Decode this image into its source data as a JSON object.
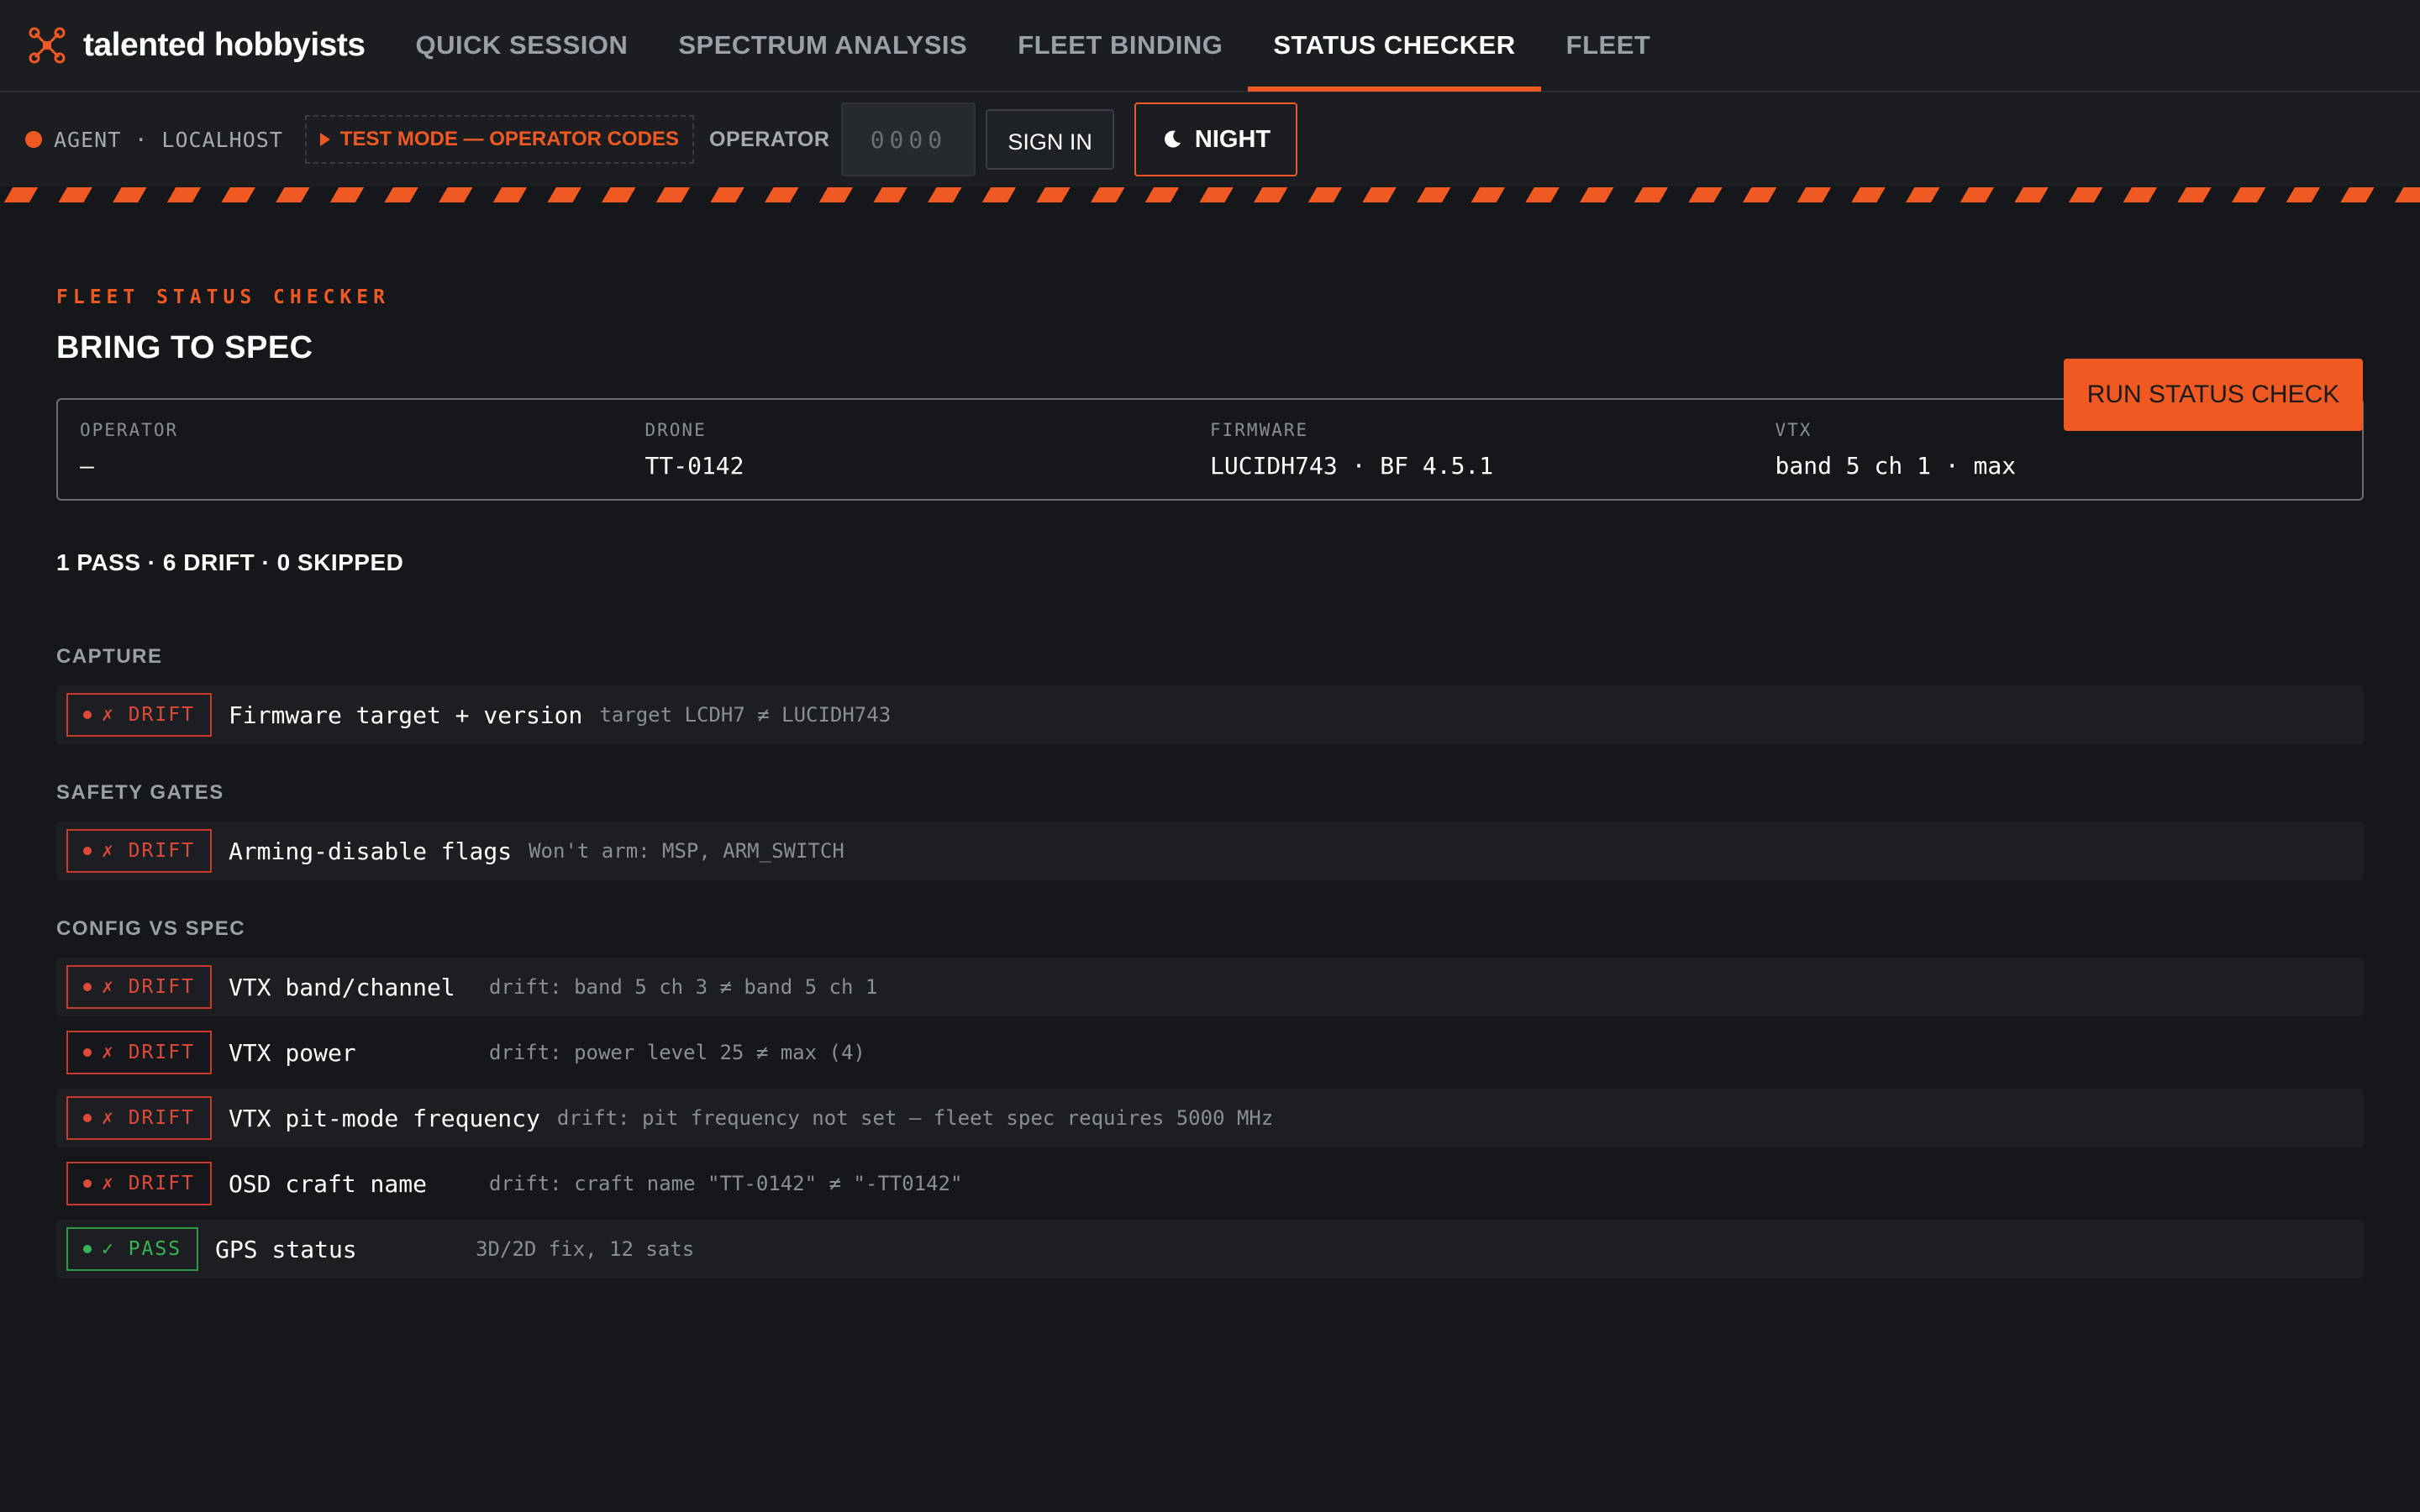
{
  "brand": {
    "name": "talented hobbyists"
  },
  "nav": {
    "tabs": [
      {
        "label": "QUICK SESSION"
      },
      {
        "label": "SPECTRUM ANALYSIS"
      },
      {
        "label": "FLEET BINDING"
      },
      {
        "label": "STATUS CHECKER",
        "active": true
      },
      {
        "label": "FLEET"
      }
    ]
  },
  "toolbar": {
    "agent_status": "AGENT · LOCALHOST",
    "test_mode": "TEST MODE — OPERATOR CODES",
    "operator_label": "OPERATOR",
    "operator_placeholder": "0000",
    "sign_in_label": "SIGN IN",
    "theme_label": "NIGHT"
  },
  "page": {
    "kicker": "FLEET STATUS CHECKER",
    "title": "BRING TO SPEC",
    "run_button": "RUN STATUS CHECK"
  },
  "info": {
    "operator": {
      "label": "OPERATOR",
      "value": "—"
    },
    "drone": {
      "label": "DRONE",
      "value": "TT-0142"
    },
    "firmware": {
      "label": "FIRMWARE",
      "value": "LUCIDH743 · BF 4.5.1"
    },
    "vtx": {
      "label": "VTX",
      "value": "band 5 ch 1 · max"
    }
  },
  "summary": "1 PASS · 6 DRIFT · 0 SKIPPED",
  "sections": [
    {
      "title": "CAPTURE",
      "checks": [
        {
          "status": "✗ DRIFT",
          "name": "Firmware target + version",
          "detail": "target LCDH7 ≠ LUCIDH743"
        }
      ]
    },
    {
      "title": "SAFETY GATES",
      "checks": [
        {
          "status": "✗ DRIFT",
          "name": "Arming-disable flags",
          "detail": "Won't arm: MSP, ARM_SWITCH"
        }
      ]
    },
    {
      "title": "CONFIG VS SPEC",
      "checks": [
        {
          "status": "✗ DRIFT",
          "name": "VTX band/channel",
          "detail": "drift: band 5 ch 3 ≠ band 5 ch 1"
        },
        {
          "status": "✗ DRIFT",
          "name": "VTX power",
          "detail": "drift: power level 25 ≠ max (4)"
        },
        {
          "status": "✗ DRIFT",
          "name": "VTX pit-mode frequency",
          "detail": "drift: pit frequency not set — fleet spec requires 5000 MHz"
        },
        {
          "status": "✗ DRIFT",
          "name": "OSD craft name",
          "detail": "drift: craft name \"TT-0142\" ≠ \"-TT0142\""
        },
        {
          "status": "✓ PASS",
          "name": "GPS status",
          "detail": "3D/2D fix, 12 sats"
        }
      ]
    }
  ],
  "colors": {
    "accent": "#f05a22",
    "drift": "#e04a3c",
    "pass": "#3ab354",
    "background": "#15171a"
  },
  "icons": {
    "brand": "drone-icon",
    "theme": "moon-icon"
  }
}
